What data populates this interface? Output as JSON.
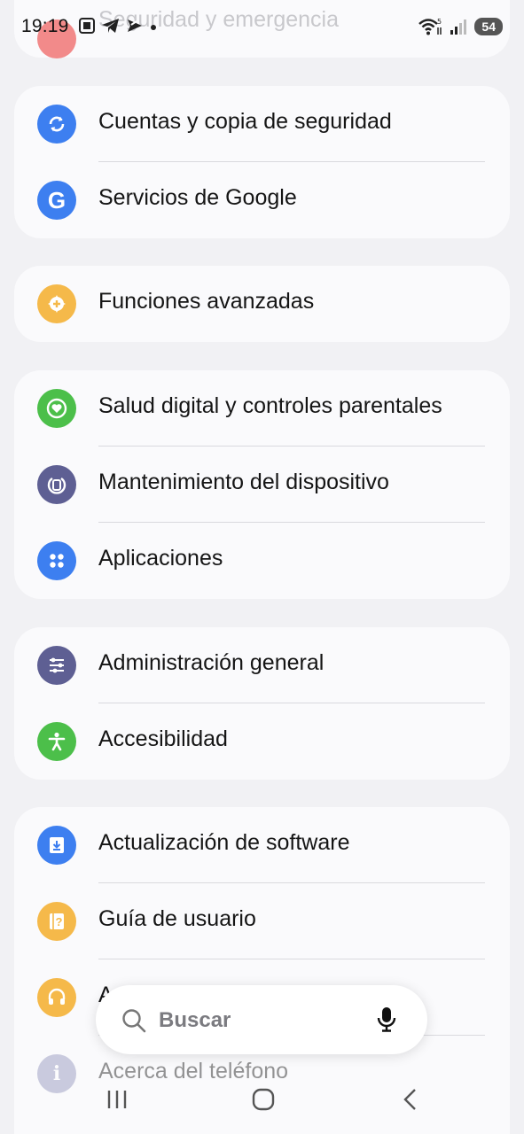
{
  "status_bar": {
    "time": "19:19",
    "battery": "54",
    "wifi_badge": "5"
  },
  "top_partial_item": {
    "label": "Seguridad y emergencia"
  },
  "groups": [
    {
      "items": [
        {
          "label": "Cuentas y copia de seguridad",
          "icon": "sync-icon",
          "color": "#3d7ff0"
        },
        {
          "label": "Servicios de Google",
          "icon": "google-g-icon",
          "color": "#3d7ff0"
        }
      ]
    },
    {
      "items": [
        {
          "label": "Funciones avanzadas",
          "icon": "gear-plus-icon",
          "color": "#f5b94a"
        }
      ]
    },
    {
      "items": [
        {
          "label": "Salud digital y controles parentales",
          "icon": "heart-circle-icon",
          "color": "#4cbf4a"
        },
        {
          "label": "Mantenimiento del dispositivo",
          "icon": "device-care-icon",
          "color": "#5e5f93"
        },
        {
          "label": "Aplicaciones",
          "icon": "apps-grid-icon",
          "color": "#3d7ff0"
        }
      ]
    },
    {
      "items": [
        {
          "label": "Administración general",
          "icon": "sliders-icon",
          "color": "#5e5f93"
        },
        {
          "label": "Accesibilidad",
          "icon": "accessibility-icon",
          "color": "#4cbf4a"
        }
      ]
    },
    {
      "items": [
        {
          "label": "Actualización de software",
          "icon": "download-icon",
          "color": "#3d7ff0"
        },
        {
          "label": "Guía de usuario",
          "icon": "help-book-icon",
          "color": "#f5b94a"
        },
        {
          "label": "A",
          "icon": "headset-icon",
          "color": "#f5b94a"
        },
        {
          "label": "Acerca del teléfono",
          "icon": "info-icon",
          "color": "#a7a9c6"
        }
      ]
    }
  ],
  "search": {
    "placeholder": "Buscar"
  },
  "nav": {
    "recents": "recents-icon",
    "home": "home-icon",
    "back": "back-icon"
  }
}
